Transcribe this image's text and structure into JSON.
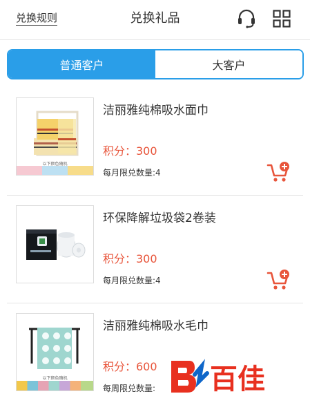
{
  "header": {
    "rules_label": "兑换规则",
    "title": "兑换礼品",
    "support_icon": "headset-icon",
    "menu_icon": "grid-icon"
  },
  "tabs": [
    {
      "label": "普通客户",
      "active": true
    },
    {
      "label": "大客户",
      "active": false
    }
  ],
  "products": [
    {
      "name": "洁丽雅纯棉吸水面巾",
      "points": "积分：300",
      "limit": "每月限兑数量:4",
      "thumb_caption": "以下颜色随机",
      "cart_icon": "add-to-cart-icon"
    },
    {
      "name": "环保降解垃圾袋2卷装",
      "points": "积分：300",
      "limit": "每月限兑数量:4",
      "cart_icon": "add-to-cart-icon"
    },
    {
      "name": "洁丽雅纯棉吸水毛巾",
      "points": "积分：600",
      "limit": "每周限兑数量:",
      "thumb_caption": "以下颜色随机",
      "cart_icon": "add-to-cart-icon"
    }
  ],
  "watermark": {
    "logo": "百佳"
  },
  "colors": {
    "accent": "#2a9ee8",
    "points": "#e8553b",
    "cart": "#e8553b"
  }
}
